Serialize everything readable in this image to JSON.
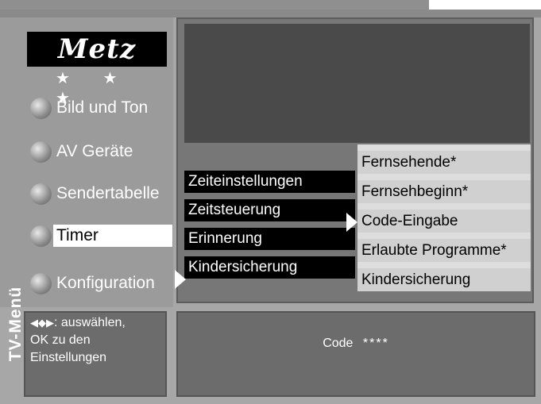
{
  "logo": {
    "brand": "Metz",
    "stars": "★ ★ ★"
  },
  "side_tag": "TV-Menü",
  "main_menu": [
    {
      "label": "Bild und Ton"
    },
    {
      "label": "AV Geräte"
    },
    {
      "label": "Sendertabelle"
    },
    {
      "label": "Timer"
    },
    {
      "label": "Konfiguration"
    }
  ],
  "submenu": [
    {
      "label": "Zeiteinstellungen"
    },
    {
      "label": "Zeitsteuerung"
    },
    {
      "label": "Erinnerung"
    },
    {
      "label": "Kindersicherung"
    }
  ],
  "options": [
    {
      "label": "Fernsehende*"
    },
    {
      "label": "Fernsehbeginn*"
    },
    {
      "label": "Code-Eingabe"
    },
    {
      "label": "Erlaubte Programme*"
    },
    {
      "label": "Kindersicherung"
    }
  ],
  "help": {
    "line1": ": auswählen,",
    "line2": "OK zu den",
    "line3": "Einstellungen"
  },
  "code": {
    "label": "Code",
    "value": "****"
  }
}
